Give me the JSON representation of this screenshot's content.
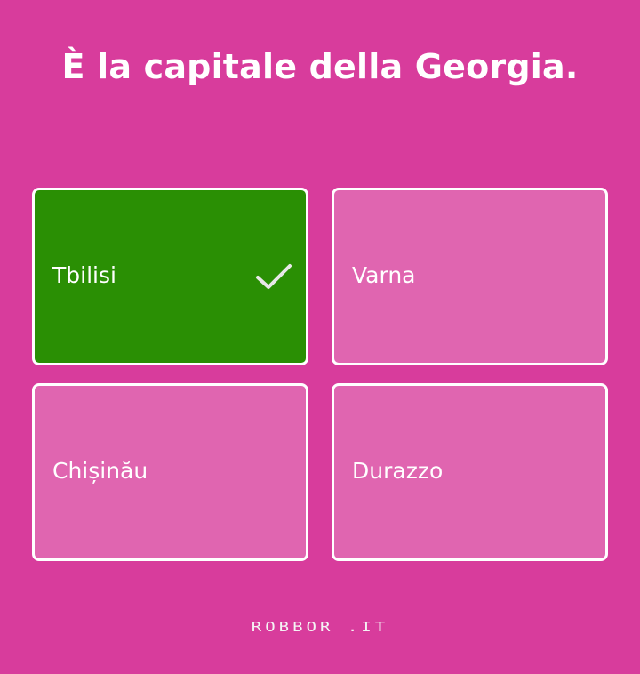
{
  "question": "È la capitale della Georgia.",
  "options": [
    {
      "label": "Tbilisi",
      "state": "correct"
    },
    {
      "label": "Varna",
      "state": "neutral"
    },
    {
      "label": "Chișinău",
      "state": "neutral"
    },
    {
      "label": "Durazzo",
      "state": "neutral"
    }
  ],
  "footer": {
    "logo_text": "ROBBOR .IT"
  },
  "icons": {
    "correct_indicator": "checkmark-icon"
  },
  "colors": {
    "background": "#d83c9c",
    "option_background": "#e065b0",
    "correct_background": "#2a8f04",
    "border": "#ffffff"
  }
}
